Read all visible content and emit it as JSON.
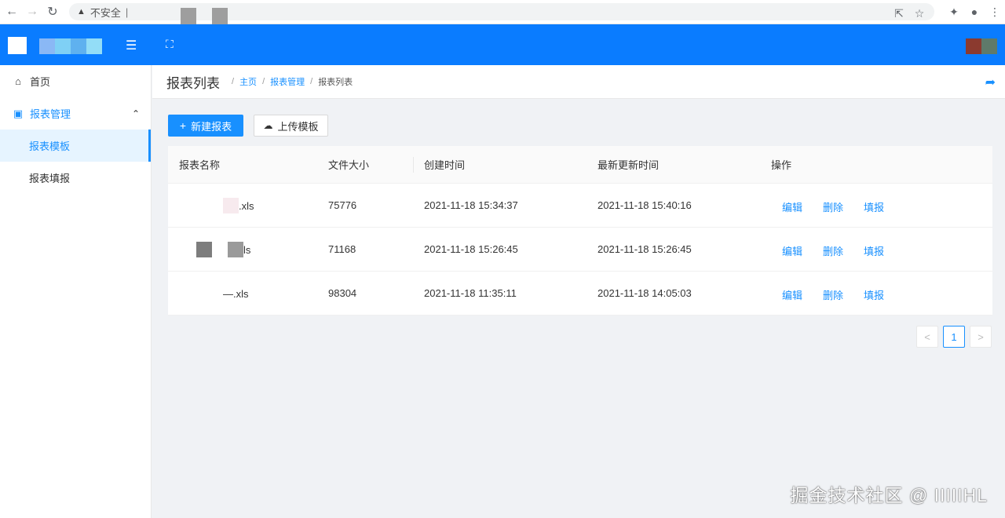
{
  "browser": {
    "security_label": "不安全",
    "url": "|",
    "icons": [
      "back-icon",
      "forward-icon",
      "reload-icon",
      "share-icon",
      "star-icon",
      "extensions-icon",
      "profile-icon",
      "menu-icon"
    ]
  },
  "colors": {
    "header": "#0a7cff",
    "accent": "#1890ff",
    "content_bg": "#f0f2f5"
  },
  "sidebar": {
    "items": [
      {
        "label": "首页",
        "icon": "home-icon"
      },
      {
        "label": "报表管理",
        "icon": "monitor-icon",
        "expanded": true,
        "children": [
          {
            "label": "报表模板",
            "active": true
          },
          {
            "label": "报表填报",
            "active": false
          }
        ]
      }
    ]
  },
  "page": {
    "title": "报表列表",
    "breadcrumb": [
      "主页",
      "报表管理",
      "报表列表"
    ]
  },
  "toolbar": {
    "new_label": "新建报表",
    "upload_label": "上传模板"
  },
  "table": {
    "headers": [
      "报表名称",
      "文件大小",
      "创建时间",
      "最新更新时间",
      "操作"
    ],
    "rows": [
      {
        "name": ".xls",
        "size": "75776",
        "created": "2021-11-18 15:34:37",
        "updated": "2021-11-18 15:40:16"
      },
      {
        "name": "ls",
        "size": "71168",
        "created": "2021-11-18 15:26:45",
        "updated": "2021-11-18 15:26:45"
      },
      {
        "name": "—.xls",
        "size": "98304",
        "created": "2021-11-18 11:35:11",
        "updated": "2021-11-18 14:05:03"
      }
    ],
    "actions": [
      "编辑",
      "删除",
      "填报"
    ]
  },
  "pagination": {
    "current": "1",
    "prev": "<",
    "next": ">"
  },
  "watermark": "掘金技术社区 @ IIIIIHL"
}
